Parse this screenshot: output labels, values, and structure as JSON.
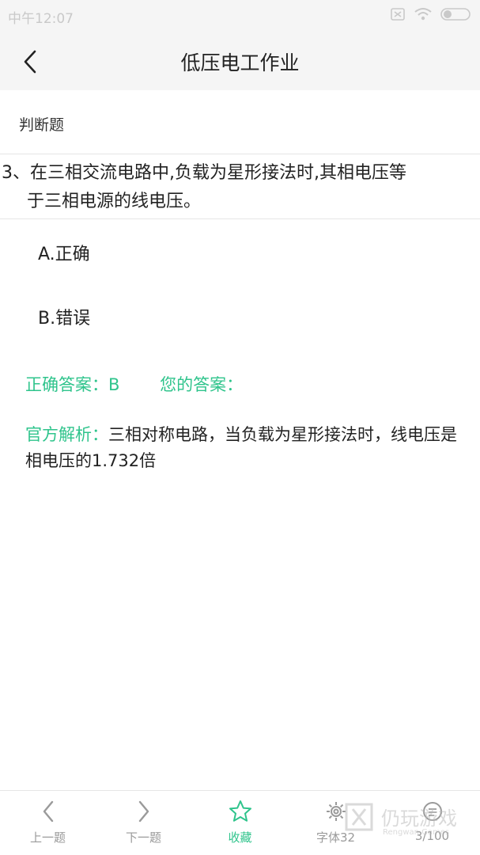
{
  "status_bar": {
    "time": "中午12:07"
  },
  "header": {
    "title": "低压电工作业"
  },
  "question_type": "判断题",
  "question": {
    "line1": "3、在三相交流电路中,负载为星形接法时,其相电压等",
    "line2": "于三相电源的线电压。"
  },
  "options": [
    {
      "label": "A.正确"
    },
    {
      "label": "B.错误"
    }
  ],
  "answers": {
    "correct": "正确答案：B",
    "yours": "您的答案："
  },
  "analysis": {
    "label": "官方解析：",
    "text": "三相对称电路，当负载为星形接法时，线电压是相电压的1.732倍"
  },
  "bottom_bar": {
    "prev": "上一题",
    "next": "下一题",
    "favorite": "收藏",
    "font": "字体32",
    "progress": "3/100"
  },
  "watermark": {
    "text": "仍玩游戏",
    "sub": "Rengwan Games"
  },
  "colors": {
    "accent": "#2fc48c",
    "bar_bg": "#f5f5f5"
  }
}
